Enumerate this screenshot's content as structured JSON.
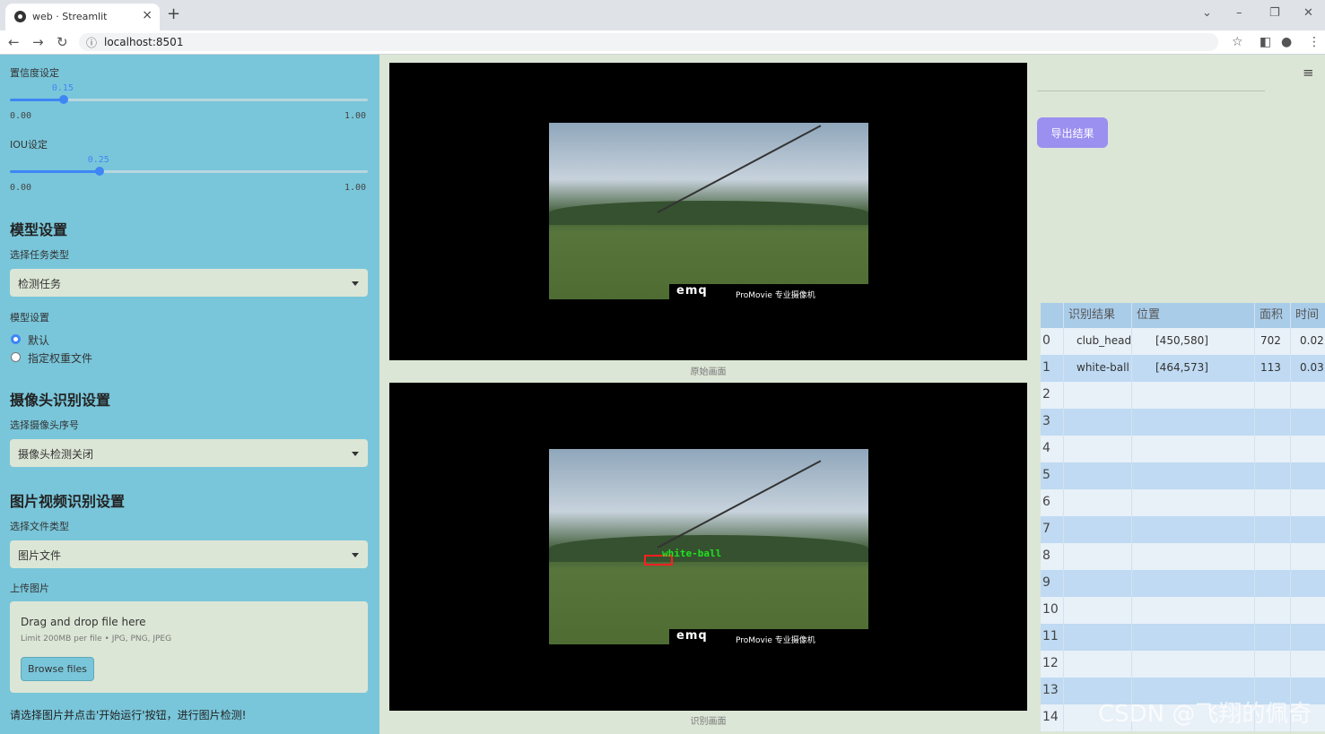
{
  "browser": {
    "tab_title": "web · Streamlit",
    "url": "localhost:8501"
  },
  "sidebar": {
    "confidence": {
      "label": "置信度设定",
      "value": "0.15",
      "value_num": 0.15,
      "min": "0.00",
      "max": "1.00"
    },
    "iou": {
      "label": "IOU设定",
      "value": "0.25",
      "value_num": 0.25,
      "min": "0.00",
      "max": "1.00"
    },
    "model_section": "模型设置",
    "task_type_label": "选择任务类型",
    "task_type_value": "检测任务",
    "model_setting_label": "模型设置",
    "model_options": [
      "默认",
      "指定权重文件"
    ],
    "camera_section": "摄像头识别设置",
    "camera_label": "选择摄像头序号",
    "camera_value": "摄像头检测关闭",
    "media_section": "图片视频识别设置",
    "file_type_label": "选择文件类型",
    "file_type_value": "图片文件",
    "upload_label": "上传图片",
    "drop_title": "Drag and drop file here",
    "drop_limit": "Limit 200MB per file • JPG, PNG, JPEG",
    "browse_label": "Browse files",
    "hint": "请选择图片并点击'开始运行'按钮，进行图片检测!"
  },
  "main": {
    "original_caption": "原始画面",
    "detected_caption": "识别画面",
    "watermark_logo": "emq",
    "watermark_text": "ProMovie 专业摄像机",
    "detection_label": "white-ball"
  },
  "results": {
    "export_label": "导出结果",
    "columns": [
      "识别结果",
      "位置",
      "面积",
      "时间"
    ],
    "rows": [
      {
        "idx": "0",
        "name": "club_head",
        "pos": "[450,580]",
        "area": "702",
        "time": "0.02"
      },
      {
        "idx": "1",
        "name": "white-ball",
        "pos": "[464,573]",
        "area": "113",
        "time": "0.03"
      },
      {
        "idx": "2"
      },
      {
        "idx": "3"
      },
      {
        "idx": "4"
      },
      {
        "idx": "5"
      },
      {
        "idx": "6"
      },
      {
        "idx": "7"
      },
      {
        "idx": "8"
      },
      {
        "idx": "9"
      },
      {
        "idx": "10"
      },
      {
        "idx": "11"
      },
      {
        "idx": "12"
      },
      {
        "idx": "13"
      },
      {
        "idx": "14"
      }
    ]
  },
  "overlay_watermark": "CSDN @飞翔的佩奇",
  "colors": {
    "sidebar": "#79c6da",
    "accent": "#3f86f5",
    "export_button": "#9b8ff0",
    "table_header": "#a9cce9"
  }
}
